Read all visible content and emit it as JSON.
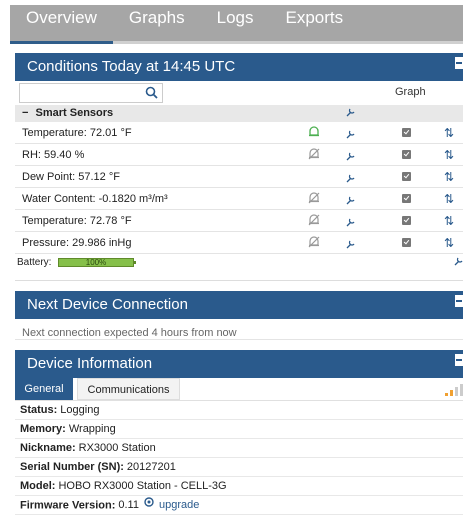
{
  "nav": {
    "tabs": [
      "Overview",
      "Graphs",
      "Logs",
      "Exports"
    ],
    "active": "Overview"
  },
  "conditions": {
    "title": "Conditions Today at 14:45 UTC",
    "search": {
      "placeholder": "",
      "value": ""
    },
    "graph_header": "Graph",
    "group": {
      "label": "Smart Sensors",
      "toggle": "−"
    },
    "rows": [
      {
        "label": "Temperature: 72.01 °F",
        "alarm": "active"
      },
      {
        "label": "RH: 59.40 %",
        "alarm": "muted"
      },
      {
        "label": "Dew Point: 57.12 °F",
        "alarm": "none"
      },
      {
        "label": "Water Content: -0.1820 m³/m³",
        "alarm": "muted"
      },
      {
        "label": "Temperature: 72.78 °F",
        "alarm": "muted"
      },
      {
        "label": "Pressure: 29.986 inHg",
        "alarm": "muted"
      }
    ],
    "battery": {
      "label": "Battery:",
      "percent_text": "100%",
      "level": 1.0
    }
  },
  "next_connection": {
    "title": "Next Device Connection",
    "text": "Next connection expected 4 hours from now"
  },
  "device_info": {
    "title": "Device Information",
    "tabs": [
      "General",
      "Communications"
    ],
    "active_tab": "General",
    "fields": [
      {
        "label": "Status:",
        "value": "Logging"
      },
      {
        "label": "Memory:",
        "value": "Wrapping"
      },
      {
        "label": "Nickname:",
        "value": "RX3000 Station"
      },
      {
        "label": "Serial Number (SN):",
        "value": "20127201"
      },
      {
        "label": "Model:",
        "value": "HOBO RX3000 Station - CELL-3G"
      },
      {
        "label": "Firmware Version:",
        "value": "0.11"
      }
    ],
    "upgrade_label": "upgrade"
  },
  "colors": {
    "header_blue": "#2a5a8c",
    "nav_gray": "#a6a6a6",
    "alarm_green": "#4caf50",
    "battery_green": "#86c04a"
  }
}
